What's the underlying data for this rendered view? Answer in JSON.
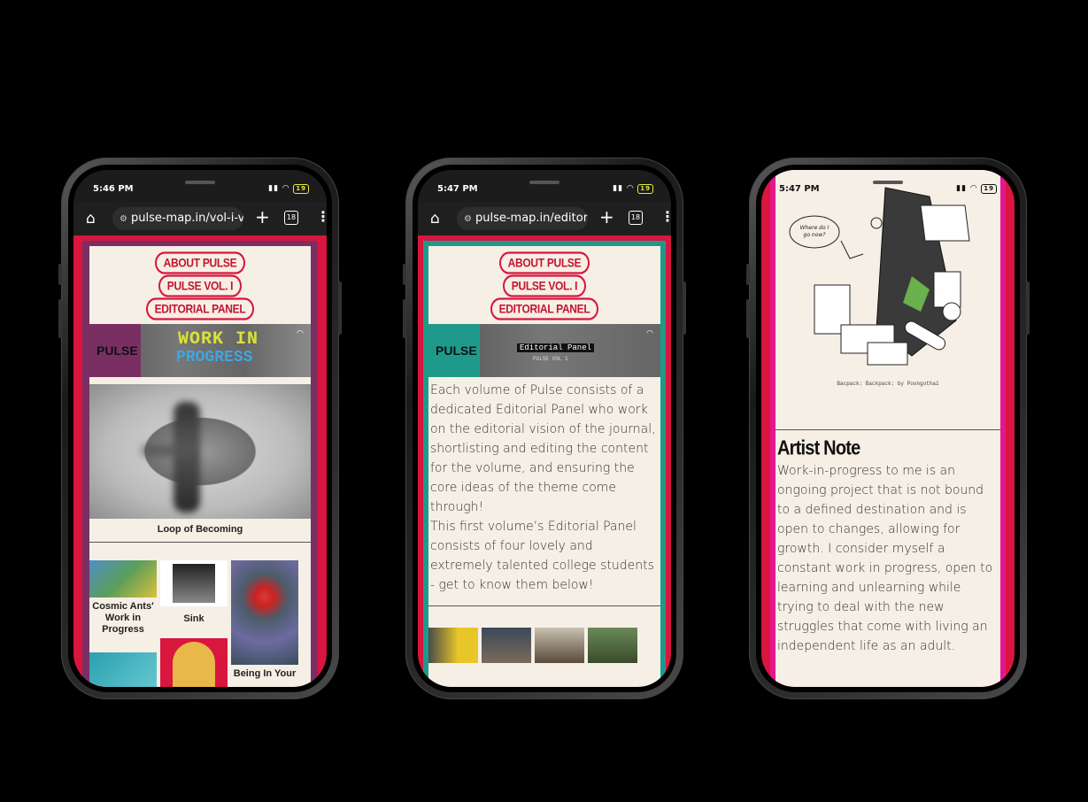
{
  "phones": [
    {
      "status": {
        "time": "5:46 PM",
        "battery": "19"
      },
      "url": "pulse-map.in/vol-i-v",
      "tab_count": "18",
      "nav": [
        "ABOUT PULSE",
        "PULSE VOL. I",
        "EDITORIAL PANEL"
      ],
      "banner": {
        "logo": "PULSE",
        "title_top": "WORK IN",
        "title_bottom": "PROGRESS"
      },
      "featured_caption": "Loop of Becoming",
      "grid_captions": [
        "Cosmic Ants' Work in Progress",
        "Sink",
        "Being In Your"
      ]
    },
    {
      "status": {
        "time": "5:47 PM",
        "battery": "19"
      },
      "url": "pulse-map.in/editor",
      "tab_count": "18",
      "nav": [
        "ABOUT PULSE",
        "PULSE VOL. I",
        "EDITORIAL PANEL"
      ],
      "banner": {
        "logo": "PULSE",
        "title": "Editorial Panel",
        "subtitle": "PULSE VOL 1"
      },
      "paragraph1": "Each volume of Pulse consists of a dedicated Editorial Panel who work on the editorial vision of the journal, shortlisting and editing the content for the volume, and ensuring the core ideas of the theme come through!",
      "paragraph2": "This first volume’s Editorial Panel consists of four lovely and extremely talented college students - get to know them below!"
    },
    {
      "status": {
        "time": "5:47 PM",
        "battery": "19"
      },
      "sketch_bubble": "Where do I go now?",
      "sketch_caption": "Bacpack: Backpack: by Poongothai",
      "heading": "Artist Note",
      "paragraph": "Work-in-progress to me is an ongoing project that is not bound to a defined destination and is open to changes, allowing for growth. I consider myself a constant work in progress, open to learning and unlearning while trying to deal with the new struggles that come with living an independent life as an adult."
    }
  ],
  "colors": {
    "crimson": "#d8163e",
    "plum": "#7a2f63",
    "teal": "#1f9a8a",
    "magenta": "#e5168f",
    "cream": "#f6efe6"
  },
  "icons": [
    "home-icon",
    "tune-icon",
    "plus-icon",
    "tabs-icon",
    "menu-dots-icon",
    "signal-icon",
    "wifi-icon",
    "battery-icon"
  ]
}
